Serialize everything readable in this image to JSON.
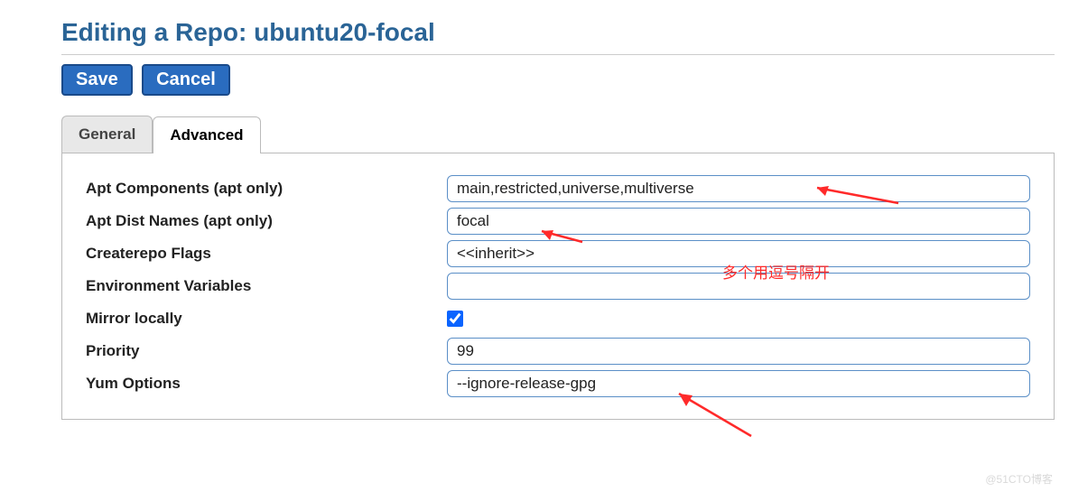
{
  "page": {
    "title": "Editing a Repo: ubuntu20-focal"
  },
  "buttons": {
    "save": "Save",
    "cancel": "Cancel"
  },
  "tabs": {
    "general": "General",
    "advanced": "Advanced"
  },
  "form": {
    "apt_components": {
      "label": "Apt Components (apt only)",
      "value": "main,restricted,universe,multiverse"
    },
    "apt_dist_names": {
      "label": "Apt Dist Names (apt only)",
      "value": "focal"
    },
    "createrepo_flags": {
      "label": "Createrepo Flags",
      "value": "<<inherit>>"
    },
    "env_vars": {
      "label": "Environment Variables",
      "value": ""
    },
    "mirror_locally": {
      "label": "Mirror locally",
      "checked": true
    },
    "priority": {
      "label": "Priority",
      "value": "99"
    },
    "yum_options": {
      "label": "Yum Options",
      "value": "--ignore-release-gpg"
    }
  },
  "annotation": {
    "text": "多个用逗号隔开"
  },
  "watermark": "@51CTO博客"
}
